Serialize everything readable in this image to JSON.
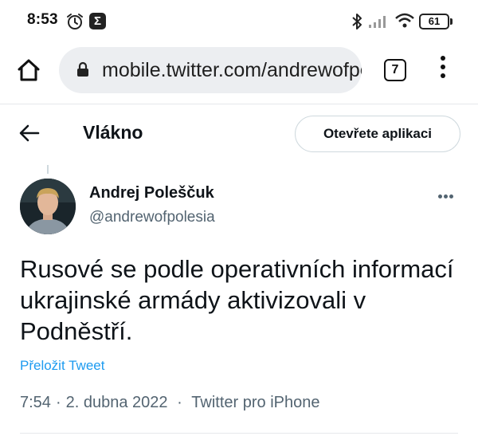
{
  "status_bar": {
    "time": "8:53",
    "app_badge": "Σ",
    "battery": "61"
  },
  "browser": {
    "url": "mobile.twitter.com/andrewofpolesia",
    "tab_count": "7"
  },
  "thread": {
    "title": "Vlákno",
    "open_app_label": "Otevřete aplikaci"
  },
  "tweet": {
    "author_name": "Andrej Poleščuk",
    "author_handle": "@andrewofpolesia",
    "text": "Rusové se podle operativních informací ukrajinské armády aktivizovali v Podněstří.",
    "translate_label": "Přeložit Tweet",
    "time": "7:54",
    "date": "2. dubna 2022",
    "source": "Twitter pro iPhone"
  },
  "icons": {
    "back": "arrow-left-icon",
    "home": "home-icon",
    "lock": "lock-icon",
    "more": "more-horizontal-icon",
    "menu": "more-vertical-icon"
  },
  "colors": {
    "link": "#1d9bf0",
    "secondary_text": "#536471",
    "url_bar_bg": "#eceef1"
  }
}
